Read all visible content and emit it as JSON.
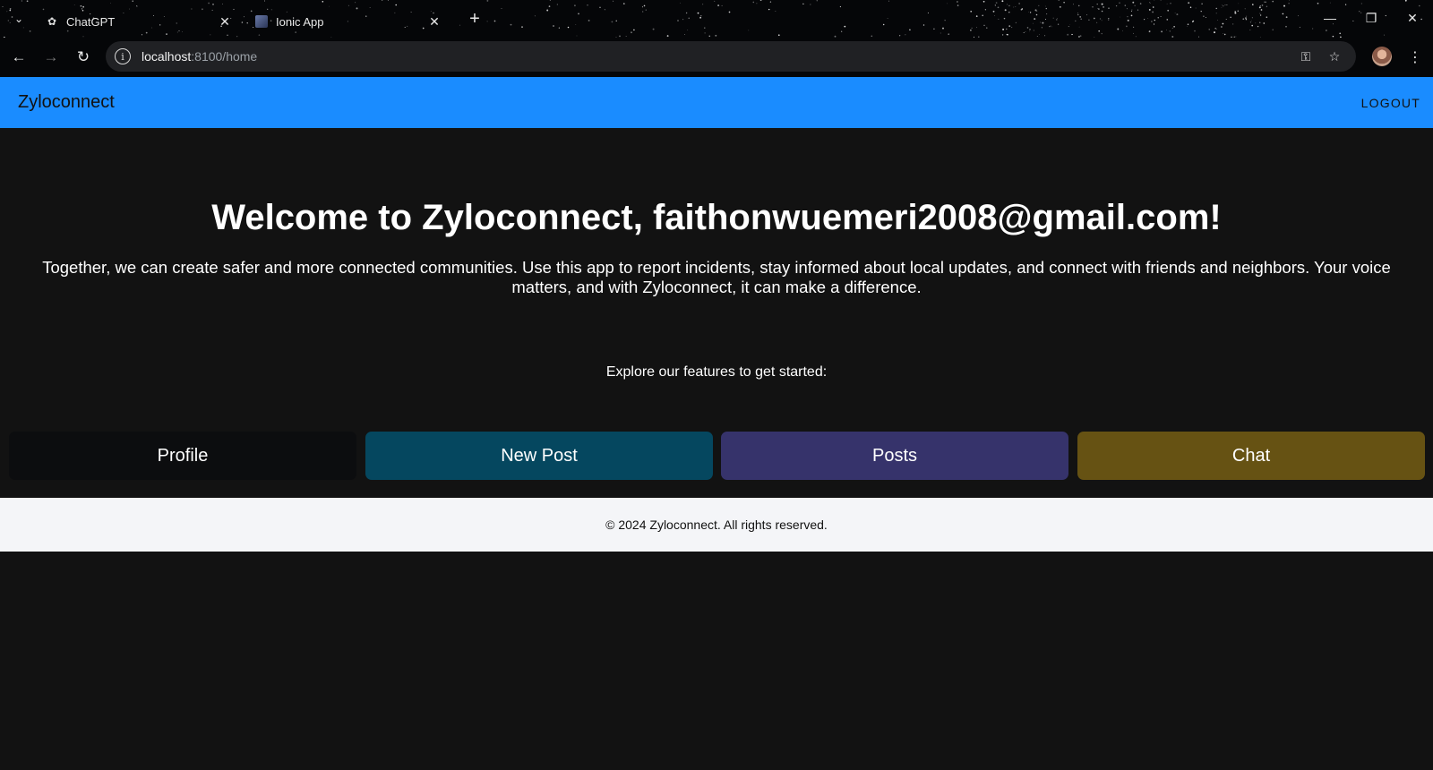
{
  "browser": {
    "tabs": [
      {
        "title": "ChatGPT",
        "icon": "openai-icon"
      },
      {
        "title": "Ionic App",
        "icon": "ionic-favicon"
      }
    ],
    "url_host": "localhost",
    "url_path": ":8100/home"
  },
  "app": {
    "title": "Zyloconnect",
    "logout_label": "LOGOUT",
    "accent_color": "#1a8cff"
  },
  "main": {
    "welcome": "Welcome to Zyloconnect, faithonwuemeri2008@gmail.com!",
    "intro": "Together, we can create safer and more connected communities. Use this app to report incidents, stay informed about local updates, and connect with friends and neighbors. Your voice matters, and with Zyloconnect, it can make a difference.",
    "explore": "Explore our features to get started:",
    "features": [
      {
        "label": "Profile",
        "color": "#0c0d0f"
      },
      {
        "label": "New Post",
        "color": "#05475f"
      },
      {
        "label": "Posts",
        "color": "#36336b"
      },
      {
        "label": "Chat",
        "color": "#665213"
      }
    ]
  },
  "footer": {
    "text": "© 2024 Zyloconnect. All rights reserved."
  }
}
